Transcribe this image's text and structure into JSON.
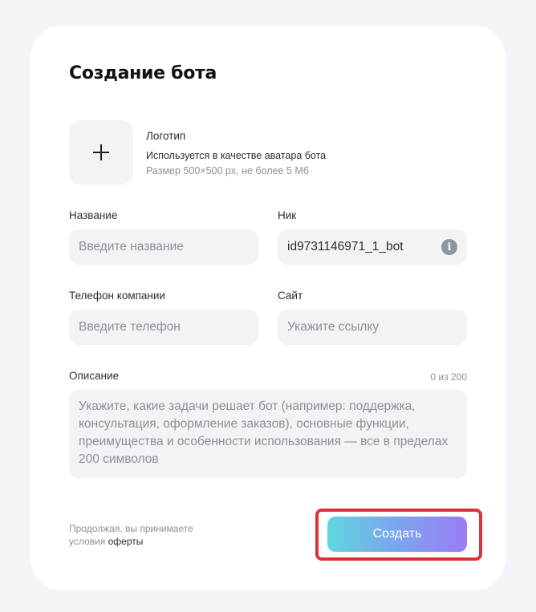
{
  "form": {
    "title": "Создание бота",
    "logo": {
      "label": "Логотип",
      "description": "Используется в качестве аватара бота",
      "hint": "Размер 500×500 px, не более 5 Мб",
      "add_icon": "plus-icon"
    },
    "name": {
      "label": "Название",
      "placeholder": "Введите название"
    },
    "nick": {
      "label": "Ник",
      "value": "id9731146971_1_bot",
      "info_icon": "info-icon",
      "info_symbol": "i"
    },
    "phone": {
      "label": "Телефон компании",
      "placeholder": "Введите телефон"
    },
    "site": {
      "label": "Сайт",
      "placeholder": "Укажите ссылку"
    },
    "description": {
      "label": "Описание",
      "counter": "0 из 200",
      "placeholder": "Укажите, какие задачи решает бот (например: поддержка, консультация, оформление заказов), основные функции, преимущества и особенности использования — все в пределах 200 символов"
    },
    "terms": {
      "line1": "Продолжая, вы принимаете",
      "line2_prefix": "условия",
      "link": "оферты"
    },
    "submit_label": "Создать"
  },
  "colors": {
    "highlight": "#d8333a",
    "button_gradient": [
      "#5fd7de",
      "#7aa5ef",
      "#9b7cf5"
    ],
    "field_bg": "#f2f3f5"
  }
}
